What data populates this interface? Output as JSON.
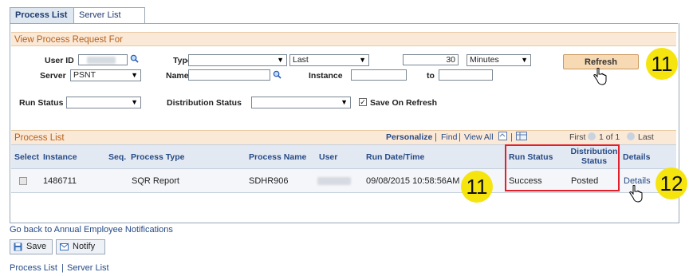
{
  "tabs": {
    "process_list": "Process List",
    "server_list": "Server List"
  },
  "filters": {
    "section_title": "View Process Request For",
    "user_id_label": "User ID",
    "type_label": "Type",
    "type_value": "",
    "last_value": "Last",
    "last_count": "30",
    "unit_value": "Minutes",
    "server_label": "Server",
    "server_value": "PSNT",
    "name_label": "Name",
    "instance_label": "Instance",
    "to_label": "to",
    "run_status_label": "Run Status",
    "distribution_status_label": "Distribution Status",
    "save_on_refresh_label": "Save On Refresh",
    "save_on_refresh_checked": true,
    "refresh_label": "Refresh"
  },
  "callouts": {
    "refresh_step": "11",
    "run_status_step": "11",
    "details_step": "12"
  },
  "grid": {
    "title": "Process List",
    "personalize": "Personalize",
    "find": "Find",
    "view_all": "View All",
    "sep1": "|",
    "sep2": "|",
    "sep3": "|",
    "first": "First",
    "range": "1 of 1",
    "last": "Last",
    "headers": {
      "select": "Select",
      "instance": "Instance",
      "seq": "Seq.",
      "process_type": "Process Type",
      "process_name": "Process Name",
      "user": "User",
      "run_datetime": "Run Date/Time",
      "run_status": "Run Status",
      "distribution_status_l1": "Distribution",
      "distribution_status_l2": "Status",
      "details": "Details"
    },
    "rows": [
      {
        "instance": "1486711",
        "seq": "",
        "process_type": "SQR Report",
        "process_name": "SDHR906",
        "run_datetime": "09/08/2015 10:58:56AM",
        "run_status": "Success",
        "distribution_status": "Posted",
        "details": "Details"
      }
    ]
  },
  "footer": {
    "go_back": "Go back to Annual Employee Notifications",
    "save_label": "Save",
    "notify_label": "Notify",
    "bottom_process_list": "Process List",
    "bottom_sep": "|",
    "bottom_server_list": "Server List"
  },
  "colors": {
    "accent_link": "#264a86",
    "section_orange": "#b8611a",
    "highlight_red": "#e0202a",
    "callout_yellow": "#f5e40d"
  }
}
